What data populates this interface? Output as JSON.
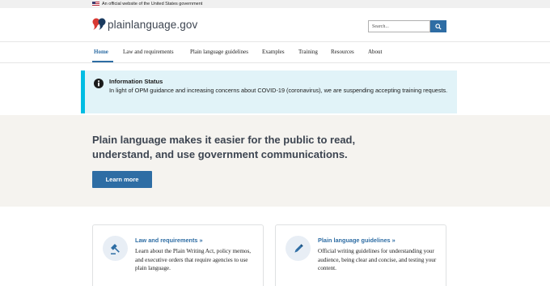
{
  "gov_banner": {
    "text": "An official website of the United States government"
  },
  "header": {
    "site_name": "plainlanguage.gov",
    "search": {
      "placeholder": "Search..."
    }
  },
  "nav": {
    "items": [
      {
        "label": "Home",
        "active": true
      },
      {
        "label": "Law and requirements",
        "active": false
      },
      {
        "label": "Plain language guidelines",
        "active": false
      },
      {
        "label": "Examples",
        "active": false
      },
      {
        "label": "Training",
        "active": false
      },
      {
        "label": "Resources",
        "active": false
      },
      {
        "label": "About",
        "active": false
      }
    ]
  },
  "alert": {
    "title": "Information Status",
    "body": "In light of OPM guidance and increasing concerns about COVID-19 (coronavirus), we are suspending accepting training requests."
  },
  "hero": {
    "heading": "Plain language makes it easier for the public to read, understand, and use government communications.",
    "button_label": "Learn more"
  },
  "cards": [
    {
      "title": "Law and requirements »",
      "body": "Learn about the Plain Writing Act, policy memos, and executive orders that require agencies to use plain language.",
      "icon": "gavel-icon"
    },
    {
      "title": "Plain language guidelines »",
      "body": "Official writing guidelines for understanding your audience, being clear and concise, and testing your content.",
      "icon": "pencil-icon"
    }
  ],
  "colors": {
    "brand_blue": "#2e6da4",
    "alert_bg": "#e1f3f8",
    "alert_border": "#00bde3",
    "hero_bg": "#f5f3ef",
    "logo_red": "#d83933",
    "logo_navy": "#1a3a5f"
  }
}
